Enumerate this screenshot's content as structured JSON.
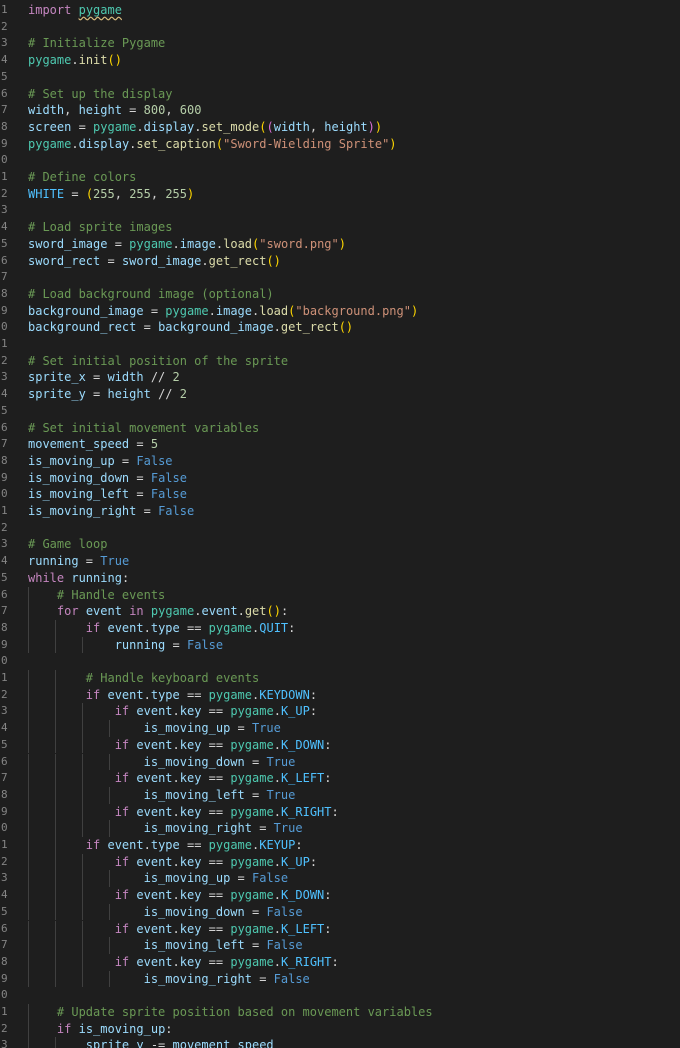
{
  "editor": {
    "language": "python",
    "theme_colors": {
      "background": "#1e1e1e",
      "keyword": "#c586c0",
      "function": "#dcdcaa",
      "variable": "#9cdcfe",
      "constant": "#4fc1ff",
      "number": "#b5cea8",
      "string": "#ce9178",
      "comment": "#6a9955",
      "boolean": "#569cd6",
      "line_number": "#858585"
    },
    "line_numbers": [
      "1",
      "2",
      "3",
      "4",
      "5",
      "6",
      "7",
      "8",
      "9",
      "0",
      "1",
      "2",
      "3",
      "4",
      "5",
      "6",
      "7",
      "8",
      "9",
      "0",
      "1",
      "2",
      "3",
      "4",
      "5",
      "6",
      "7",
      "8",
      "9",
      "0",
      "1",
      "2",
      "3",
      "4",
      "5",
      "6",
      "7",
      "8",
      "9",
      "0",
      "1",
      "2",
      "3",
      "4",
      "5",
      "6",
      "7",
      "8",
      "9",
      "0",
      "1",
      "2",
      "3",
      "4",
      "5",
      "6",
      "7",
      "8",
      "9",
      "0",
      "1",
      "2",
      "3"
    ],
    "lines": [
      [
        [
          "kw",
          "import"
        ],
        [
          "op",
          " "
        ],
        [
          "mod squig",
          "pygame"
        ]
      ],
      [],
      [
        [
          "com",
          "# Initialize Pygame"
        ]
      ],
      [
        [
          "mod",
          "pygame"
        ],
        [
          "op",
          "."
        ],
        [
          "fn",
          "init"
        ],
        [
          "p1",
          "()"
        ]
      ],
      [],
      [
        [
          "com",
          "# Set up the display"
        ]
      ],
      [
        [
          "var",
          "width"
        ],
        [
          "op",
          ", "
        ],
        [
          "var",
          "height"
        ],
        [
          "op",
          " = "
        ],
        [
          "num",
          "800"
        ],
        [
          "op",
          ", "
        ],
        [
          "num",
          "600"
        ]
      ],
      [
        [
          "var",
          "screen"
        ],
        [
          "op",
          " = "
        ],
        [
          "mod",
          "pygame"
        ],
        [
          "op",
          "."
        ],
        [
          "var",
          "display"
        ],
        [
          "op",
          "."
        ],
        [
          "fn",
          "set_mode"
        ],
        [
          "p1",
          "("
        ],
        [
          "p2",
          "("
        ],
        [
          "var",
          "width"
        ],
        [
          "op",
          ", "
        ],
        [
          "var",
          "height"
        ],
        [
          "p2",
          ")"
        ],
        [
          "p1",
          ")"
        ]
      ],
      [
        [
          "mod",
          "pygame"
        ],
        [
          "op",
          "."
        ],
        [
          "var",
          "display"
        ],
        [
          "op",
          "."
        ],
        [
          "fn",
          "set_caption"
        ],
        [
          "p1",
          "("
        ],
        [
          "str",
          "\"Sword-Wielding Sprite\""
        ],
        [
          "p1",
          ")"
        ]
      ],
      [],
      [
        [
          "com",
          "# Define colors"
        ]
      ],
      [
        [
          "const",
          "WHITE"
        ],
        [
          "op",
          " = "
        ],
        [
          "p1",
          "("
        ],
        [
          "num",
          "255"
        ],
        [
          "op",
          ", "
        ],
        [
          "num",
          "255"
        ],
        [
          "op",
          ", "
        ],
        [
          "num",
          "255"
        ],
        [
          "p1",
          ")"
        ]
      ],
      [],
      [
        [
          "com",
          "# Load sprite images"
        ]
      ],
      [
        [
          "var",
          "sword_image"
        ],
        [
          "op",
          " = "
        ],
        [
          "mod",
          "pygame"
        ],
        [
          "op",
          "."
        ],
        [
          "var",
          "image"
        ],
        [
          "op",
          "."
        ],
        [
          "fn",
          "load"
        ],
        [
          "p1",
          "("
        ],
        [
          "str",
          "\"sword.png\""
        ],
        [
          "p1",
          ")"
        ]
      ],
      [
        [
          "var",
          "sword_rect"
        ],
        [
          "op",
          " = "
        ],
        [
          "var",
          "sword_image"
        ],
        [
          "op",
          "."
        ],
        [
          "fn",
          "get_rect"
        ],
        [
          "p1",
          "()"
        ]
      ],
      [],
      [
        [
          "com",
          "# Load background image (optional)"
        ]
      ],
      [
        [
          "var",
          "background_image"
        ],
        [
          "op",
          " = "
        ],
        [
          "mod",
          "pygame"
        ],
        [
          "op",
          "."
        ],
        [
          "var",
          "image"
        ],
        [
          "op",
          "."
        ],
        [
          "fn",
          "load"
        ],
        [
          "p1",
          "("
        ],
        [
          "str",
          "\"background.png\""
        ],
        [
          "p1",
          ")"
        ]
      ],
      [
        [
          "var",
          "background_rect"
        ],
        [
          "op",
          " = "
        ],
        [
          "var",
          "background_image"
        ],
        [
          "op",
          "."
        ],
        [
          "fn",
          "get_rect"
        ],
        [
          "p1",
          "()"
        ]
      ],
      [],
      [
        [
          "com",
          "# Set initial position of the sprite"
        ]
      ],
      [
        [
          "var",
          "sprite_x"
        ],
        [
          "op",
          " = "
        ],
        [
          "var",
          "width"
        ],
        [
          "op",
          " // "
        ],
        [
          "num",
          "2"
        ]
      ],
      [
        [
          "var",
          "sprite_y"
        ],
        [
          "op",
          " = "
        ],
        [
          "var",
          "height"
        ],
        [
          "op",
          " // "
        ],
        [
          "num",
          "2"
        ]
      ],
      [],
      [
        [
          "com",
          "# Set initial movement variables"
        ]
      ],
      [
        [
          "var",
          "movement_speed"
        ],
        [
          "op",
          " = "
        ],
        [
          "num",
          "5"
        ]
      ],
      [
        [
          "var",
          "is_moving_up"
        ],
        [
          "op",
          " = "
        ],
        [
          "bool",
          "False"
        ]
      ],
      [
        [
          "var",
          "is_moving_down"
        ],
        [
          "op",
          " = "
        ],
        [
          "bool",
          "False"
        ]
      ],
      [
        [
          "var",
          "is_moving_left"
        ],
        [
          "op",
          " = "
        ],
        [
          "bool",
          "False"
        ]
      ],
      [
        [
          "var",
          "is_moving_right"
        ],
        [
          "op",
          " = "
        ],
        [
          "bool",
          "False"
        ]
      ],
      [],
      [
        [
          "com",
          "# Game loop"
        ]
      ],
      [
        [
          "var",
          "running"
        ],
        [
          "op",
          " = "
        ],
        [
          "bool",
          "True"
        ]
      ],
      [
        [
          "kw",
          "while"
        ],
        [
          "op",
          " "
        ],
        [
          "var",
          "running"
        ],
        [
          "op",
          ":"
        ]
      ],
      [
        [
          "op",
          "    "
        ],
        [
          "com",
          "# Handle events"
        ]
      ],
      [
        [
          "op",
          "    "
        ],
        [
          "kw",
          "for"
        ],
        [
          "op",
          " "
        ],
        [
          "var",
          "event"
        ],
        [
          "op",
          " "
        ],
        [
          "kw",
          "in"
        ],
        [
          "op",
          " "
        ],
        [
          "mod",
          "pygame"
        ],
        [
          "op",
          "."
        ],
        [
          "var",
          "event"
        ],
        [
          "op",
          "."
        ],
        [
          "fn",
          "get"
        ],
        [
          "p1",
          "()"
        ],
        [
          "op",
          ":"
        ]
      ],
      [
        [
          "op",
          "        "
        ],
        [
          "kw",
          "if"
        ],
        [
          "op",
          " "
        ],
        [
          "var",
          "event"
        ],
        [
          "op",
          "."
        ],
        [
          "var",
          "type"
        ],
        [
          "op",
          " == "
        ],
        [
          "mod",
          "pygame"
        ],
        [
          "op",
          "."
        ],
        [
          "const",
          "QUIT"
        ],
        [
          "op",
          ":"
        ]
      ],
      [
        [
          "op",
          "            "
        ],
        [
          "var",
          "running"
        ],
        [
          "op",
          " = "
        ],
        [
          "bool",
          "False"
        ]
      ],
      [],
      [
        [
          "op",
          "        "
        ],
        [
          "com",
          "# Handle keyboard events"
        ]
      ],
      [
        [
          "op",
          "        "
        ],
        [
          "kw",
          "if"
        ],
        [
          "op",
          " "
        ],
        [
          "var",
          "event"
        ],
        [
          "op",
          "."
        ],
        [
          "var",
          "type"
        ],
        [
          "op",
          " == "
        ],
        [
          "mod",
          "pygame"
        ],
        [
          "op",
          "."
        ],
        [
          "const",
          "KEYDOWN"
        ],
        [
          "op",
          ":"
        ]
      ],
      [
        [
          "op",
          "            "
        ],
        [
          "kw",
          "if"
        ],
        [
          "op",
          " "
        ],
        [
          "var",
          "event"
        ],
        [
          "op",
          "."
        ],
        [
          "var",
          "key"
        ],
        [
          "op",
          " == "
        ],
        [
          "mod",
          "pygame"
        ],
        [
          "op",
          "."
        ],
        [
          "const",
          "K_UP"
        ],
        [
          "op",
          ":"
        ]
      ],
      [
        [
          "op",
          "                "
        ],
        [
          "var",
          "is_moving_up"
        ],
        [
          "op",
          " = "
        ],
        [
          "bool",
          "True"
        ]
      ],
      [
        [
          "op",
          "            "
        ],
        [
          "kw",
          "if"
        ],
        [
          "op",
          " "
        ],
        [
          "var",
          "event"
        ],
        [
          "op",
          "."
        ],
        [
          "var",
          "key"
        ],
        [
          "op",
          " == "
        ],
        [
          "mod",
          "pygame"
        ],
        [
          "op",
          "."
        ],
        [
          "const",
          "K_DOWN"
        ],
        [
          "op",
          ":"
        ]
      ],
      [
        [
          "op",
          "                "
        ],
        [
          "var",
          "is_moving_down"
        ],
        [
          "op",
          " = "
        ],
        [
          "bool",
          "True"
        ]
      ],
      [
        [
          "op",
          "            "
        ],
        [
          "kw",
          "if"
        ],
        [
          "op",
          " "
        ],
        [
          "var",
          "event"
        ],
        [
          "op",
          "."
        ],
        [
          "var",
          "key"
        ],
        [
          "op",
          " == "
        ],
        [
          "mod",
          "pygame"
        ],
        [
          "op",
          "."
        ],
        [
          "const",
          "K_LEFT"
        ],
        [
          "op",
          ":"
        ]
      ],
      [
        [
          "op",
          "                "
        ],
        [
          "var",
          "is_moving_left"
        ],
        [
          "op",
          " = "
        ],
        [
          "bool",
          "True"
        ]
      ],
      [
        [
          "op",
          "            "
        ],
        [
          "kw",
          "if"
        ],
        [
          "op",
          " "
        ],
        [
          "var",
          "event"
        ],
        [
          "op",
          "."
        ],
        [
          "var",
          "key"
        ],
        [
          "op",
          " == "
        ],
        [
          "mod",
          "pygame"
        ],
        [
          "op",
          "."
        ],
        [
          "const",
          "K_RIGHT"
        ],
        [
          "op",
          ":"
        ]
      ],
      [
        [
          "op",
          "                "
        ],
        [
          "var",
          "is_moving_right"
        ],
        [
          "op",
          " = "
        ],
        [
          "bool",
          "True"
        ]
      ],
      [
        [
          "op",
          "        "
        ],
        [
          "kw",
          "if"
        ],
        [
          "op",
          " "
        ],
        [
          "var",
          "event"
        ],
        [
          "op",
          "."
        ],
        [
          "var",
          "type"
        ],
        [
          "op",
          " == "
        ],
        [
          "mod",
          "pygame"
        ],
        [
          "op",
          "."
        ],
        [
          "const",
          "KEYUP"
        ],
        [
          "op",
          ":"
        ]
      ],
      [
        [
          "op",
          "            "
        ],
        [
          "kw",
          "if"
        ],
        [
          "op",
          " "
        ],
        [
          "var",
          "event"
        ],
        [
          "op",
          "."
        ],
        [
          "var",
          "key"
        ],
        [
          "op",
          " == "
        ],
        [
          "mod",
          "pygame"
        ],
        [
          "op",
          "."
        ],
        [
          "const",
          "K_UP"
        ],
        [
          "op",
          ":"
        ]
      ],
      [
        [
          "op",
          "                "
        ],
        [
          "var",
          "is_moving_up"
        ],
        [
          "op",
          " = "
        ],
        [
          "bool",
          "False"
        ]
      ],
      [
        [
          "op",
          "            "
        ],
        [
          "kw",
          "if"
        ],
        [
          "op",
          " "
        ],
        [
          "var",
          "event"
        ],
        [
          "op",
          "."
        ],
        [
          "var",
          "key"
        ],
        [
          "op",
          " == "
        ],
        [
          "mod",
          "pygame"
        ],
        [
          "op",
          "."
        ],
        [
          "const",
          "K_DOWN"
        ],
        [
          "op",
          ":"
        ]
      ],
      [
        [
          "op",
          "                "
        ],
        [
          "var",
          "is_moving_down"
        ],
        [
          "op",
          " = "
        ],
        [
          "bool",
          "False"
        ]
      ],
      [
        [
          "op",
          "            "
        ],
        [
          "kw",
          "if"
        ],
        [
          "op",
          " "
        ],
        [
          "var",
          "event"
        ],
        [
          "op",
          "."
        ],
        [
          "var",
          "key"
        ],
        [
          "op",
          " == "
        ],
        [
          "mod",
          "pygame"
        ],
        [
          "op",
          "."
        ],
        [
          "const",
          "K_LEFT"
        ],
        [
          "op",
          ":"
        ]
      ],
      [
        [
          "op",
          "                "
        ],
        [
          "var",
          "is_moving_left"
        ],
        [
          "op",
          " = "
        ],
        [
          "bool",
          "False"
        ]
      ],
      [
        [
          "op",
          "            "
        ],
        [
          "kw",
          "if"
        ],
        [
          "op",
          " "
        ],
        [
          "var",
          "event"
        ],
        [
          "op",
          "."
        ],
        [
          "var",
          "key"
        ],
        [
          "op",
          " == "
        ],
        [
          "mod",
          "pygame"
        ],
        [
          "op",
          "."
        ],
        [
          "const",
          "K_RIGHT"
        ],
        [
          "op",
          ":"
        ]
      ],
      [
        [
          "op",
          "                "
        ],
        [
          "var",
          "is_moving_right"
        ],
        [
          "op",
          " = "
        ],
        [
          "bool",
          "False"
        ]
      ],
      [],
      [
        [
          "op",
          "    "
        ],
        [
          "com",
          "# Update sprite position based on movement variables"
        ]
      ],
      [
        [
          "op",
          "    "
        ],
        [
          "kw",
          "if"
        ],
        [
          "op",
          " "
        ],
        [
          "var",
          "is_moving_up"
        ],
        [
          "op",
          ":"
        ]
      ],
      [
        [
          "op",
          "        "
        ],
        [
          "var",
          "sprite_y"
        ],
        [
          "op",
          " -= "
        ],
        [
          "var",
          "movement_speed"
        ]
      ]
    ]
  }
}
